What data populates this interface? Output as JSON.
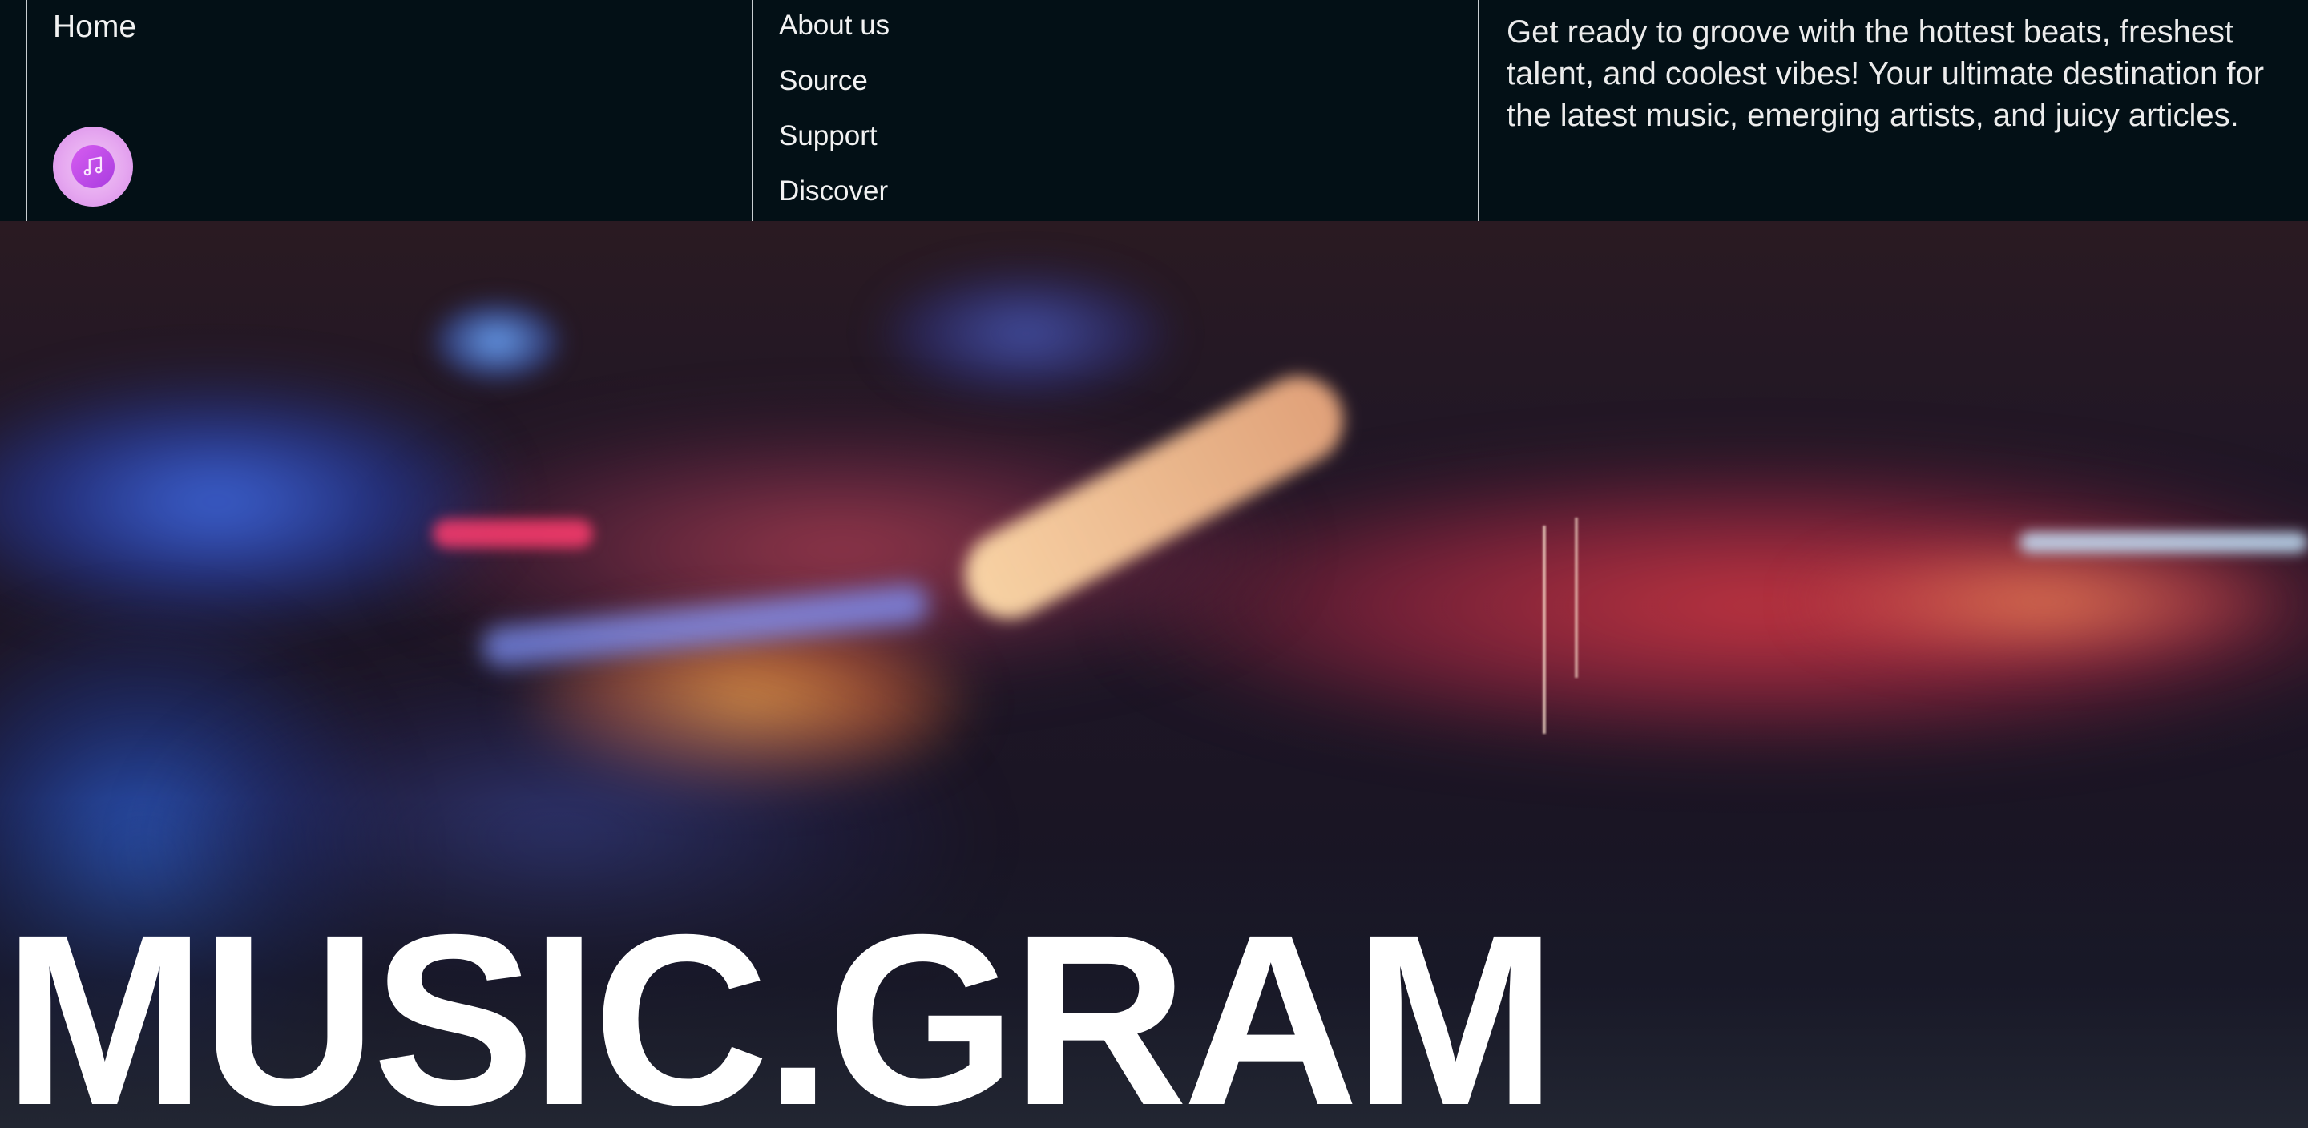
{
  "header": {
    "home_label": "Home",
    "logo_icon": "music-note-icon",
    "nav": [
      {
        "label": "About us"
      },
      {
        "label": "Source"
      },
      {
        "label": "Support"
      },
      {
        "label": "Discover"
      }
    ],
    "tagline": "Get ready to groove with the hottest beats, freshest talent, and coolest vibes! Your ultimate destination for the latest music, emerging artists, and juicy articles."
  },
  "hero": {
    "title": "MUSIC.GRAM",
    "background_image": "blurred-turntable-photo"
  },
  "colors": {
    "header_bg": "#031016",
    "text": "#f2f2f2",
    "logo_accent": "#d65df0",
    "divider": "#c9ced1"
  }
}
